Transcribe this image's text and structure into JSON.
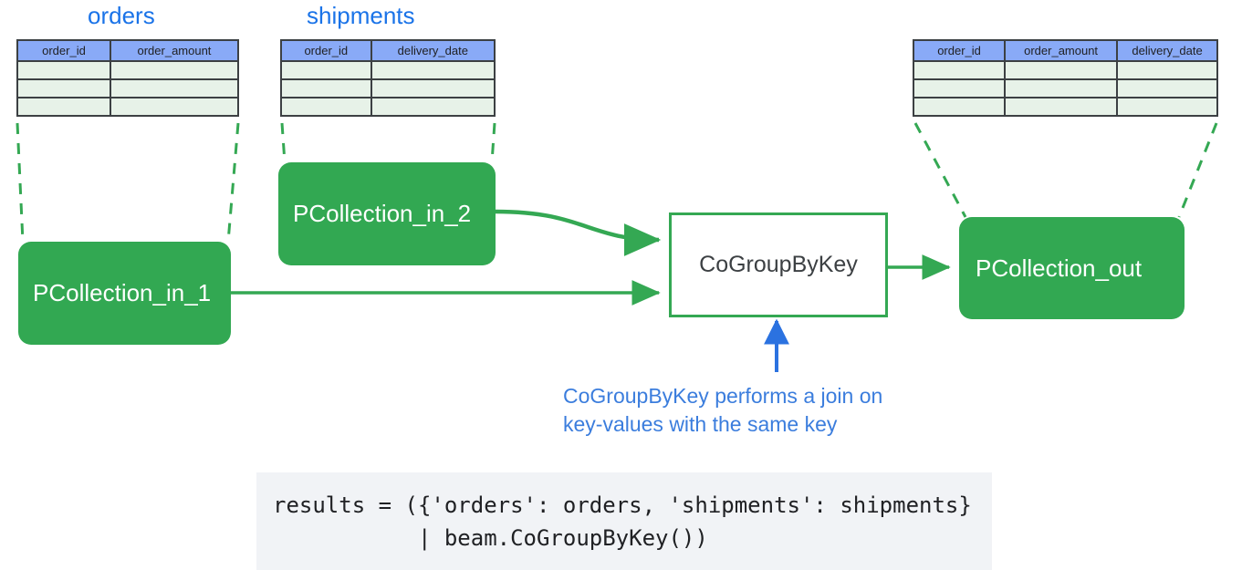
{
  "diagram": {
    "title_orders": "orders",
    "title_shipments": "shipments"
  },
  "tables": {
    "orders": {
      "name": "orders",
      "columns": [
        "order_id",
        "order_amount"
      ],
      "empty_rows": 3
    },
    "shipments": {
      "name": "shipments",
      "columns": [
        "order_id",
        "delivery_date"
      ],
      "empty_rows": 3
    },
    "output": {
      "columns": [
        "order_id",
        "order_amount",
        "delivery_date"
      ],
      "empty_rows": 3
    }
  },
  "nodes": {
    "pcollection_in_1": "PCollection_in_1",
    "pcollection_in_2": "PCollection_in_2",
    "transform": "CoGroupByKey",
    "pcollection_out": "PCollection_out"
  },
  "annotation": {
    "line1": "CoGroupByKey performs a join on",
    "line2": "key-values with the same key"
  },
  "code": {
    "line1": "results = ({'orders': orders, 'shipments': shipments}",
    "line2": "           | beam.CoGroupByKey())"
  },
  "colors": {
    "accent_blue": "#1a73e8",
    "annotation_blue": "#3b7ddd",
    "green_fill": "#32a852",
    "green_stroke": "#34a853",
    "header_blue": "#89aaf7",
    "row_green": "#e7f2e8",
    "border_dark": "#3c4043",
    "code_bg": "#f1f3f6"
  }
}
